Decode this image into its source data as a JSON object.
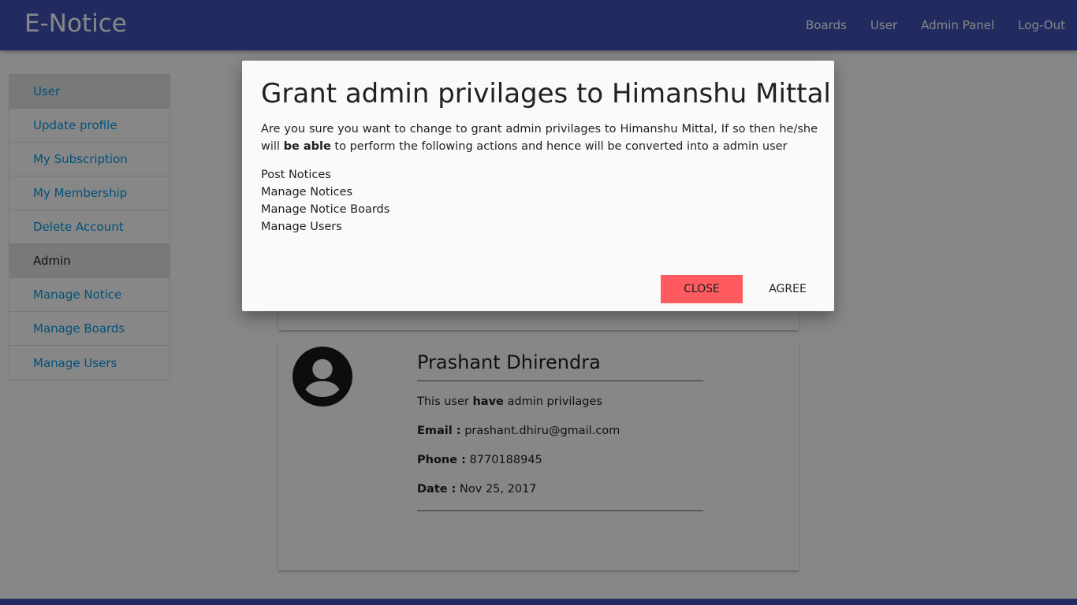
{
  "navbar": {
    "brand": "E-Notice",
    "links": [
      "Boards",
      "User",
      "Admin Panel",
      "Log-Out"
    ]
  },
  "sidebar": {
    "items": [
      {
        "label": "User"
      },
      {
        "label": "Update profile"
      },
      {
        "label": "My Subscription"
      },
      {
        "label": "My Membership"
      },
      {
        "label": "Delete Account"
      },
      {
        "label": "Admin"
      },
      {
        "label": "Manage Notice"
      },
      {
        "label": "Manage Boards"
      },
      {
        "label": "Manage Users"
      }
    ]
  },
  "user_card": {
    "avatar_icon": "account-circle-icon",
    "name": "Prashant Dhirendra",
    "status_prefix": "This user ",
    "status_bold": "have",
    "status_suffix": " admin privilages",
    "email_label": "Email :",
    "email": "prashant.dhiru@gmail.com",
    "phone_label": "Phone :",
    "phone": "8770188945",
    "date_label": "Date :",
    "date": "Nov 25, 2017"
  },
  "modal": {
    "title": "Grant admin privilages to Himanshu Mittal",
    "text_prefix": "Are you sure you want to change to grant admin privilages to Himanshu Mittal, If so then he/she will ",
    "text_bold": "be able",
    "text_suffix": " to perform the following actions and hence will be converted into a admin user",
    "actions": [
      "Post Notices",
      "Manage Notices",
      "Manage Notice Boards",
      "Manage Users"
    ],
    "close_label": "Close",
    "agree_label": "Agree"
  },
  "colors": {
    "navbar": "#3f51b5",
    "close_button": "#ff5a5f",
    "sidebar_link": "#039be5"
  }
}
